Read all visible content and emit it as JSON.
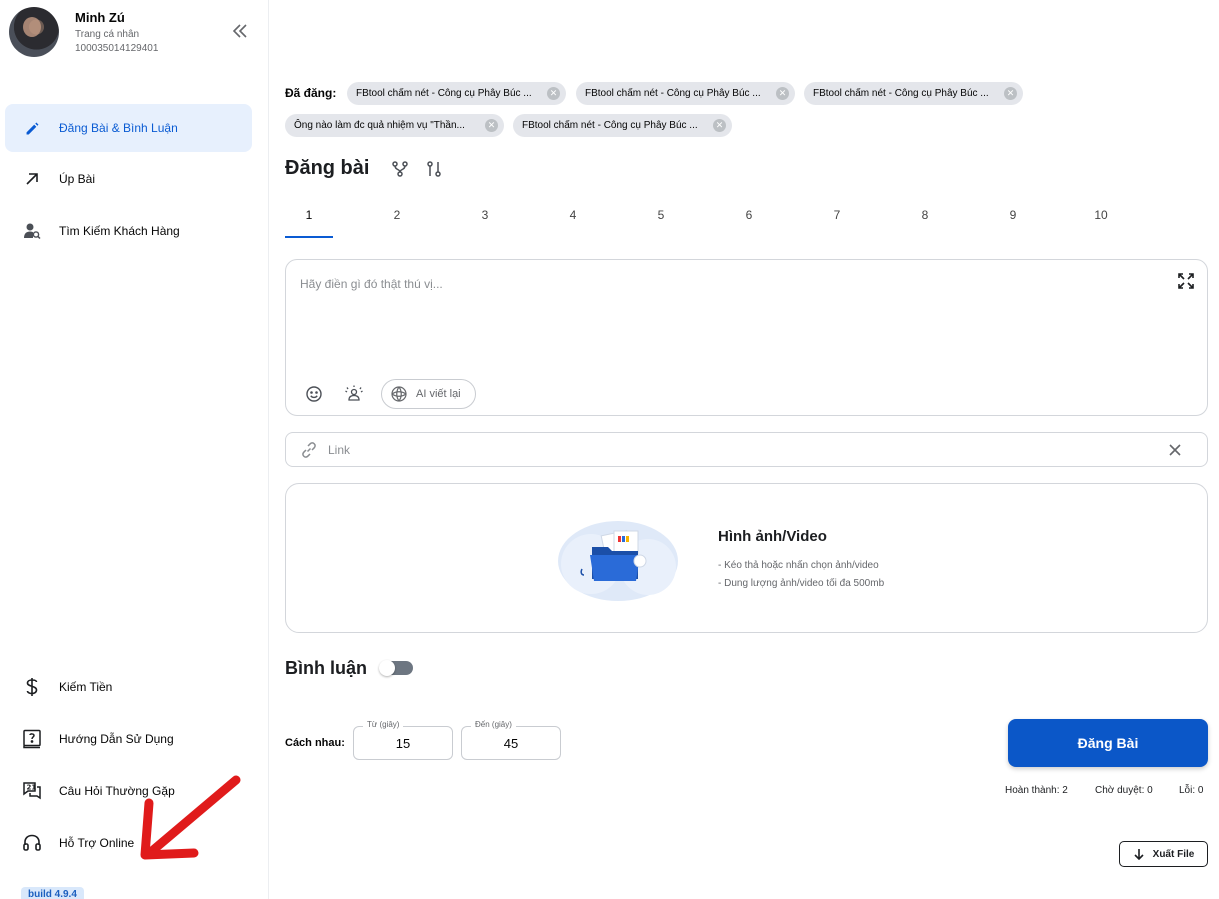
{
  "profile": {
    "name": "Minh Zú",
    "subtitle": "Trang cá nhân",
    "id": "100035014129401"
  },
  "sidebar": {
    "items": [
      {
        "label": "Đăng Bài & Bình Luận",
        "icon": "pencil-icon",
        "active": true
      },
      {
        "label": "Úp Bài",
        "icon": "arrow-up-right-icon"
      },
      {
        "label": "Tìm Kiếm Khách Hàng",
        "icon": "user-search-icon"
      }
    ],
    "bottom_items": [
      {
        "label": "Kiếm Tiền",
        "icon": "dollar-icon"
      },
      {
        "label": "Hướng Dẫn Sử Dụng",
        "icon": "help-book-icon"
      },
      {
        "label": "Câu Hỏi Thường Gặp",
        "icon": "faq-icon"
      },
      {
        "label": "Hỗ Trợ Online",
        "icon": "headset-icon"
      }
    ],
    "build": "build 4.9.4"
  },
  "posted": {
    "label": "Đã đăng:",
    "chips": [
      "FBtool chấm nét - Công cụ Phây Búc ...",
      "FBtool chấm nét - Công cụ Phây Búc ...",
      "FBtool chấm nét - Công cụ Phây Búc ...",
      "Ông nào làm đc quả nhiệm vụ \"Thần...",
      "FBtool chấm nét - Công cụ Phây Búc ..."
    ]
  },
  "post": {
    "title": "Đăng bài",
    "tabs": [
      "1",
      "2",
      "3",
      "4",
      "5",
      "6",
      "7",
      "8",
      "9",
      "10"
    ],
    "active_tab": "1",
    "placeholder": "Hãy điền gì đó thật thú vị...",
    "ai_label": "AI viết lại",
    "link_placeholder": "Link"
  },
  "media": {
    "title": "Hình ảnh/Video",
    "line1": "- Kéo thả hoặc nhấn chọn ảnh/video",
    "line2": "- Dung lượng ảnh/video tối đa 500mb"
  },
  "comment": {
    "title": "Bình luận",
    "enabled": false
  },
  "delay": {
    "label": "Cách nhau:",
    "from_caption": "Từ (giây)",
    "from_value": "15",
    "to_caption": "Đến (giây)",
    "to_value": "45"
  },
  "actions": {
    "post_button": "Đăng Bài",
    "export_button": "Xuất File"
  },
  "stats": {
    "done": "Hoàn thành: 2",
    "pending": "Chờ duyệt: 0",
    "error": "Lỗi: 0"
  },
  "colors": {
    "accent": "#0b57c8",
    "active_bg": "#e7f0fd",
    "annotation_arrow": "#e01b1b"
  }
}
